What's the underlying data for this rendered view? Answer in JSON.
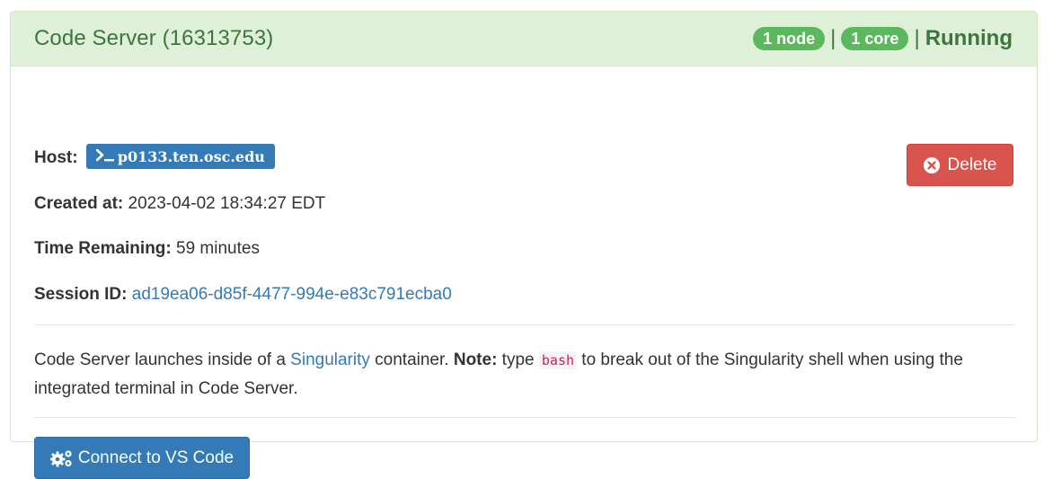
{
  "session": {
    "title": "Code Server (16313753)",
    "badges": {
      "nodes": "1 node",
      "cores": "1 core"
    },
    "separator": "|",
    "status": "Running"
  },
  "details": {
    "host_label": "Host:",
    "host_value": "p0133.ten.osc.edu",
    "created_label": "Created at:",
    "created_value": "2023-04-02 18:34:27 EDT",
    "time_label": "Time Remaining:",
    "time_value": "59 minutes",
    "session_id_label": "Session ID:",
    "session_id_value": "ad19ea06-d85f-4477-994e-e83c791ecba0"
  },
  "actions": {
    "delete_label": "Delete",
    "connect_label": "Connect to VS Code"
  },
  "description": {
    "part1": "Code Server launches inside of a ",
    "singularity_link": "Singularity",
    "part2": " container. ",
    "note_label": "Note:",
    "part3": " type ",
    "code": "bash",
    "part4": " to break out of the Singularity shell when using the integrated terminal in Code Server."
  },
  "icons": {
    "host": "terminal-icon",
    "delete": "times-circle-icon",
    "connect": "cogs-icon"
  },
  "colors": {
    "header_bg": "#dff0d8",
    "header_text": "#3c763d",
    "badge_bg": "#5cb85c",
    "primary": "#337ab7",
    "danger": "#d9534f",
    "code_text": "#c7254e"
  }
}
